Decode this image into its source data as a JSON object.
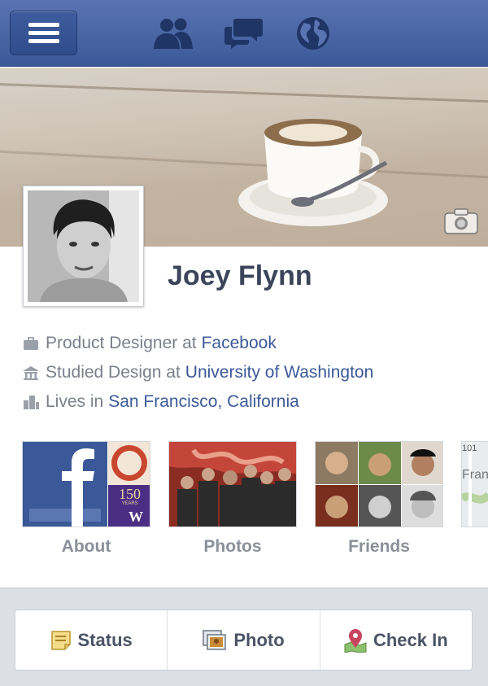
{
  "nav": {
    "menu_icon": "hamburger-icon",
    "friends_icon": "friend-requests-icon",
    "messages_icon": "messages-icon",
    "notifications_icon": "globe-icon"
  },
  "profile": {
    "name": "Joey Flynn",
    "work_prefix": "Product Designer at",
    "work_link": "Facebook",
    "education_prefix": "Studied Design at",
    "education_link": "University of Washington",
    "location_prefix": "Lives in",
    "location_link": "San Francisco, California"
  },
  "tiles": {
    "about": "About",
    "photos": "Photos",
    "friends": "Friends",
    "about_badge_text": "150",
    "about_badge_sub": "YEARS",
    "about_badge_letter": "W",
    "map_text_101": "101",
    "map_text_city": "Franc"
  },
  "composer": {
    "status": "Status",
    "photo": "Photo",
    "check_in": "Check In"
  },
  "colors": {
    "brand_blue": "#3b5998",
    "link_blue": "#3b5998"
  }
}
